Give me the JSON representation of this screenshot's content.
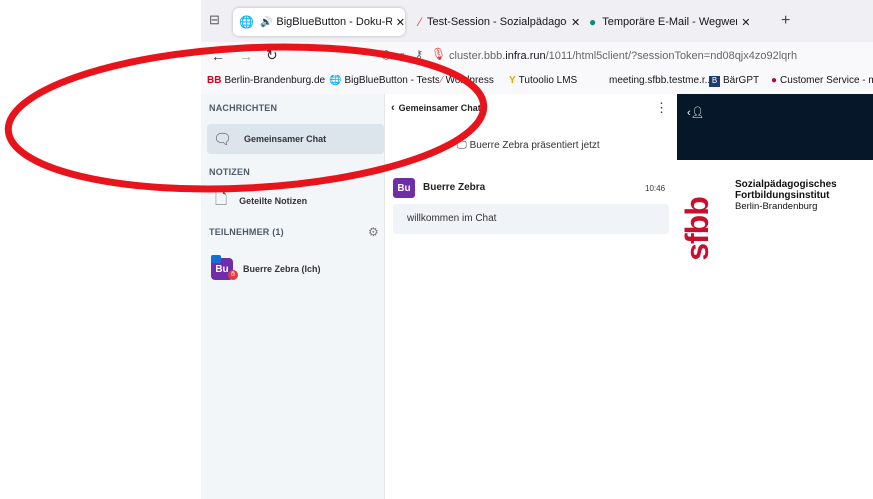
{
  "browser": {
    "tabs": [
      {
        "label": "BigBlueButton - Doku-Raum",
        "icon": "globe-icon"
      },
      {
        "label": "Test-Session - Sozialpädagogisc",
        "icon": "wordpress-icon"
      },
      {
        "label": "Temporäre E-Mail - Wegwerf E",
        "icon": "mail-icon"
      }
    ],
    "new_tab": "+",
    "url_host": "cluster.bbb.",
    "url_domain": "infra.run",
    "url_path": "/1011/html5client/?sessionToken=nd08qjx4zo92lqrh",
    "bookmarks": [
      {
        "label": "Berlin-Brandenburg.de",
        "badge": "BB"
      },
      {
        "label": "BigBlueButton - Testse"
      },
      {
        "label": "Wordpress"
      },
      {
        "label": "Tutoolio LMS"
      },
      {
        "label": "meeting.sfbb.testme.r..."
      },
      {
        "label": "BärGPT"
      },
      {
        "label": "Customer Service - m"
      }
    ]
  },
  "sidebar": {
    "messages_title": "NACHRICHTEN",
    "public_chat": "Gemeinsamer Chat",
    "notes_title": "NOTIZEN",
    "shared_notes": "Geteilte Notizen",
    "participants_title": "TEILNEHMER (1)",
    "participant": {
      "initials": "Bu",
      "name": "Buerre Zebra (Ich)"
    }
  },
  "chat": {
    "header": "Gemeinsamer Chat",
    "presenting": "Buerre Zebra präsentiert jetzt",
    "sender": "Buerre Zebra",
    "initials": "Bu",
    "time": "10:46",
    "message": "willkommen im Chat"
  },
  "presentation": {
    "logo_text": "sfbb",
    "line1": "Sozialpädagogisches",
    "line2": "Fortbildungsinstitut",
    "line3": "Berlin-Brandenburg"
  },
  "colors": {
    "accent": "#6f2da8",
    "logo_red": "#c8102e",
    "annotation": "#e8141c",
    "dark_bar": "#06172a"
  }
}
